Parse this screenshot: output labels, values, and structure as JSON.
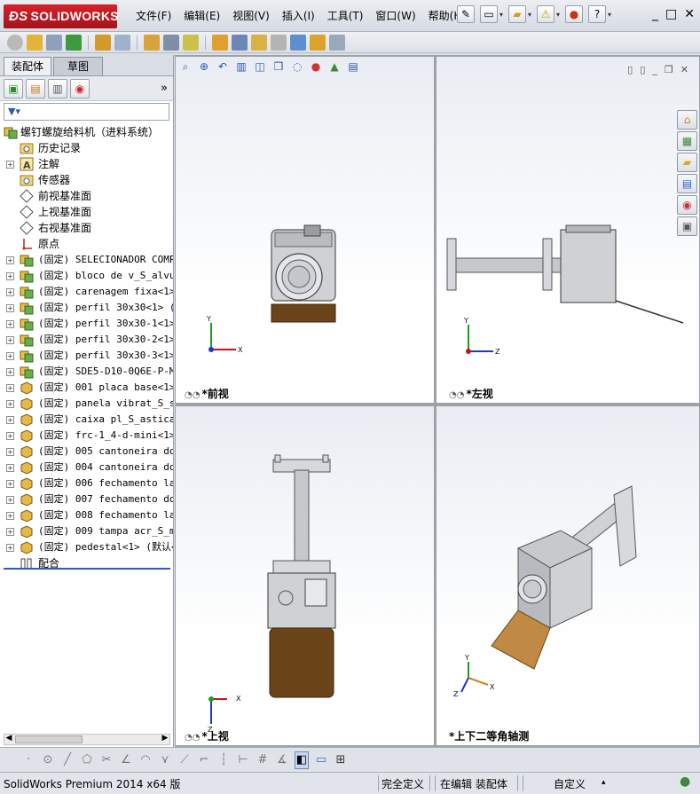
{
  "app": {
    "name": "SOLIDWORKS",
    "menus": [
      {
        "label": "文件(F)"
      },
      {
        "label": "编辑(E)"
      },
      {
        "label": "视图(V)"
      },
      {
        "label": "插入(I)"
      },
      {
        "label": "工具(T)"
      },
      {
        "label": "窗口(W)"
      },
      {
        "label": "帮助(H)"
      }
    ],
    "window_controls": [
      "_",
      "□",
      "✕"
    ]
  },
  "panel": {
    "tabs": {
      "assembly": "装配体",
      "sketch": "草图"
    },
    "expand_glyph": "»",
    "tree": {
      "root": "螺钉螺旋给料机（进料系统）",
      "items": [
        {
          "label": "历史记录",
          "type": "folder"
        },
        {
          "label": "注解",
          "type": "annotation",
          "expandable": true
        },
        {
          "label": "传感器",
          "type": "sensor"
        },
        {
          "label": "前视基准面",
          "type": "plane"
        },
        {
          "label": "上视基准面",
          "type": "plane"
        },
        {
          "label": "右视基准面",
          "type": "plane"
        },
        {
          "label": "原点",
          "type": "origin"
        }
      ],
      "components": [
        {
          "state": "(固定)",
          "name": "SELECIONADOR COMPL",
          "kind": "asm"
        },
        {
          "state": "(固定)",
          "name": "bloco de v_S_alvul",
          "kind": "asm"
        },
        {
          "state": "(固定)",
          "name": "carenagem fixa<1>",
          "kind": "asm"
        },
        {
          "state": "(固定)",
          "name": "perfil 30x30<1> (默",
          "kind": "asm"
        },
        {
          "state": "(固定)",
          "name": "perfil 30x30-1<1>",
          "kind": "asm"
        },
        {
          "state": "(固定)",
          "name": "perfil 30x30-2<1>",
          "kind": "asm"
        },
        {
          "state": "(固定)",
          "name": "perfil 30x30-3<1>",
          "kind": "asm"
        },
        {
          "state": "(固定)",
          "name": "SDE5-D10-0Q6E-P-M8",
          "kind": "asm"
        },
        {
          "state": "(固定)",
          "name": "001 placa base<1>",
          "kind": "part"
        },
        {
          "state": "(固定)",
          "name": "panela vibrat_S_sr",
          "kind": "part"
        },
        {
          "state": "(固定)",
          "name": "caixa pl_S_astica",
          "kind": "part"
        },
        {
          "state": "(固定)",
          "name": "frc-1_4-d-mini<1>",
          "kind": "part"
        },
        {
          "state": "(固定)",
          "name": "005 cantoneira do",
          "kind": "part"
        },
        {
          "state": "(固定)",
          "name": "004 cantoneira do",
          "kind": "part"
        },
        {
          "state": "(固定)",
          "name": "006 fechamento lat",
          "kind": "part"
        },
        {
          "state": "(固定)",
          "name": "007 fechamento do",
          "kind": "part"
        },
        {
          "state": "(固定)",
          "name": "008 fechamento lat",
          "kind": "part"
        },
        {
          "state": "(固定)",
          "name": "009 tampa acr_S_ml",
          "kind": "part"
        },
        {
          "state": "(固定)",
          "name": "pedestal<1> (默认<",
          "kind": "part"
        }
      ],
      "mates": "配合"
    }
  },
  "views": {
    "front": "*前视",
    "left": "*左视",
    "top": "*上视",
    "iso": "*上下二等角轴测"
  },
  "axes": {
    "x": "X",
    "y": "Y",
    "z": "Z"
  },
  "status": {
    "product": "SolidWorks Premium 2014 x64 版",
    "definition": "完全定义",
    "mode": "在编辑 装配体",
    "custom": "自定义",
    "arrow": "▴"
  },
  "colors": {
    "brand_red": "#c8161e",
    "brown_tray": "#6b4519",
    "iso_plate": "#c08a44",
    "part_gray": "#a9acb0",
    "axis_x": "#d01010",
    "axis_y": "#18a018",
    "axis_z": "#1a3acb"
  }
}
